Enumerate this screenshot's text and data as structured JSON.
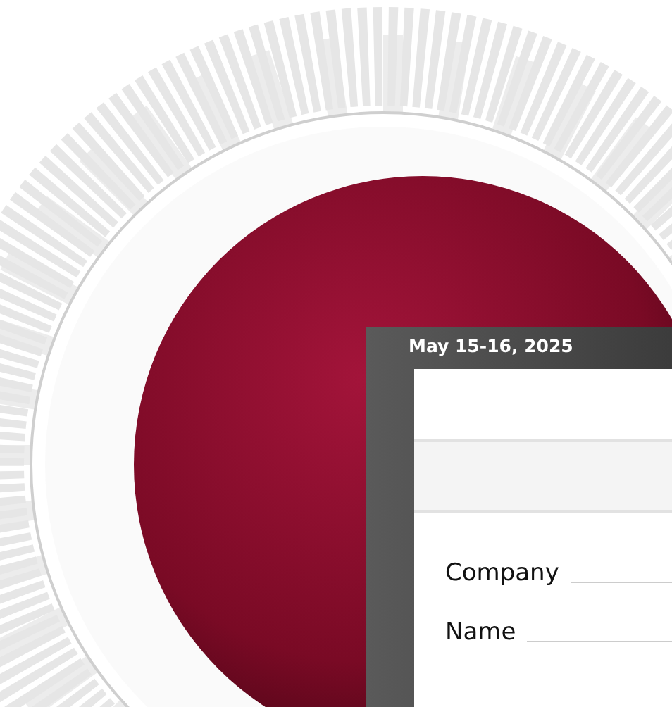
{
  "panel": {
    "title": "May 15-16, 2025",
    "fields": [
      {
        "label": "Company"
      },
      {
        "label": "Name"
      }
    ]
  }
}
